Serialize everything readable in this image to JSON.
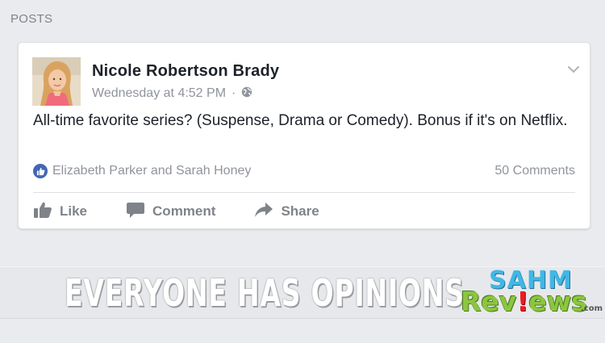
{
  "section": {
    "title": "POSTS"
  },
  "post": {
    "author": "Nicole Robertson Brady",
    "timestamp": "Wednesday at 4:52 PM",
    "separator": "·",
    "privacy_icon": "globe-icon",
    "text": "All-time favorite series? (Suspense, Drama or Comedy). Bonus if it's on Netflix.",
    "reactions": {
      "icon": "like-reaction-icon",
      "names": "Elizabeth Parker and Sarah Honey"
    },
    "comments_count": "50 Comments",
    "actions": [
      {
        "label": "Like",
        "icon": "thumbs-up-icon"
      },
      {
        "label": "Comment",
        "icon": "comment-bubble-icon"
      },
      {
        "label": "Share",
        "icon": "share-arrow-icon"
      }
    ]
  },
  "banner": {
    "text": "EVERYONE HAS OPINIONS"
  },
  "logo": {
    "top": "SAHM",
    "bottom_start": "Rev",
    "bottom_bang": "!",
    "bottom_end": "ews",
    "suffix": ".com"
  },
  "colors": {
    "background": "#e9ebee",
    "card": "#ffffff",
    "text_primary": "#1d2129",
    "text_secondary": "#90949c",
    "like_blue": "#4267b2",
    "logo_blue": "#3fb8e6",
    "logo_green": "#8cc63f",
    "logo_red": "#ed1c24"
  }
}
